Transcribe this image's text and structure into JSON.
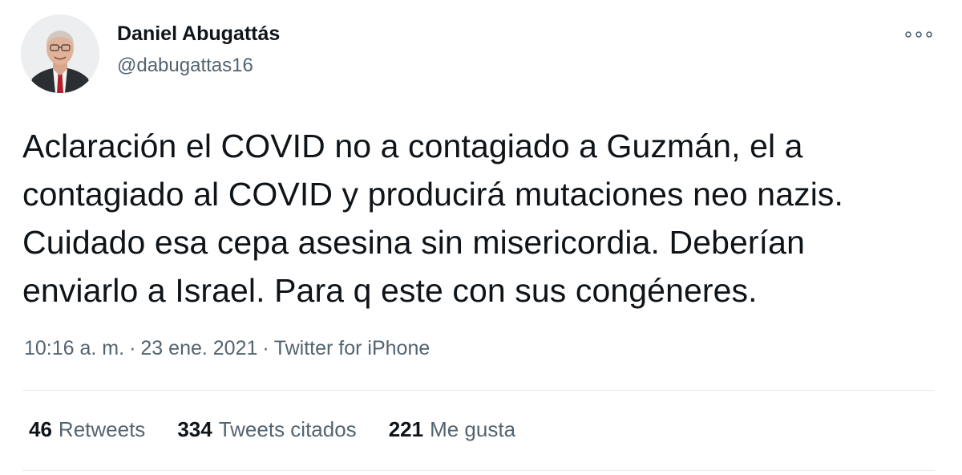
{
  "author": {
    "display_name": "Daniel Abugattás",
    "handle": "@dabugattas16"
  },
  "tweet": {
    "lines": [
      "Aclaración el COVID no a contagiado a Guzmán, el a",
      "contagiado al COVID y producirá mutaciones neo nazis.",
      "Cuidado esa cepa asesina sin misericordia. Deberían",
      "enviarlo a Israel. Para q este con sus congéneres."
    ],
    "time": "10:16 a. m.",
    "date": "23 ene. 2021",
    "separator": "·",
    "source": "Twitter for iPhone"
  },
  "stats": {
    "retweets_count": "46",
    "retweets_label": "Retweets",
    "quotes_count": "334",
    "quotes_label": "Tweets citados",
    "likes_count": "221",
    "likes_label": "Me gusta"
  },
  "colors": {
    "text_primary": "#0f1419",
    "text_secondary": "#536471",
    "divider": "#e6ecf0"
  },
  "icons": {
    "more": "more-dots-icon"
  }
}
